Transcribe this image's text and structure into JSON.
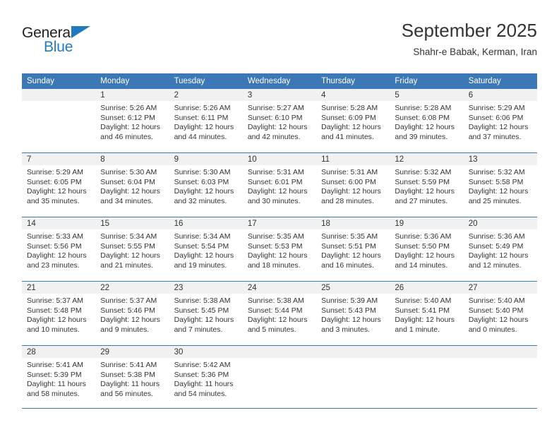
{
  "brand": {
    "name_part1": "General",
    "name_part2": "Blue",
    "accent_color": "#1f7ac0"
  },
  "header": {
    "title": "September 2025",
    "subtitle": "Shahr-e Babak, Kerman, Iran",
    "header_bg_color": "#3b78b5",
    "daynum_band_color": "#f1f1f1"
  },
  "weekdays": [
    "Sunday",
    "Monday",
    "Tuesday",
    "Wednesday",
    "Thursday",
    "Friday",
    "Saturday"
  ],
  "labels": {
    "sunrise_prefix": "Sunrise:",
    "sunset_prefix": "Sunset:",
    "daylight_prefix": "Daylight:"
  },
  "weeks": [
    [
      {
        "day": "",
        "sunrise": "",
        "sunset": "",
        "daylight_line1": "",
        "daylight_line2": "",
        "empty": true
      },
      {
        "day": "1",
        "sunrise": "Sunrise: 5:26 AM",
        "sunset": "Sunset: 6:12 PM",
        "daylight_line1": "Daylight: 12 hours",
        "daylight_line2": "and 46 minutes.",
        "empty": false
      },
      {
        "day": "2",
        "sunrise": "Sunrise: 5:26 AM",
        "sunset": "Sunset: 6:11 PM",
        "daylight_line1": "Daylight: 12 hours",
        "daylight_line2": "and 44 minutes.",
        "empty": false
      },
      {
        "day": "3",
        "sunrise": "Sunrise: 5:27 AM",
        "sunset": "Sunset: 6:10 PM",
        "daylight_line1": "Daylight: 12 hours",
        "daylight_line2": "and 42 minutes.",
        "empty": false
      },
      {
        "day": "4",
        "sunrise": "Sunrise: 5:28 AM",
        "sunset": "Sunset: 6:09 PM",
        "daylight_line1": "Daylight: 12 hours",
        "daylight_line2": "and 41 minutes.",
        "empty": false
      },
      {
        "day": "5",
        "sunrise": "Sunrise: 5:28 AM",
        "sunset": "Sunset: 6:08 PM",
        "daylight_line1": "Daylight: 12 hours",
        "daylight_line2": "and 39 minutes.",
        "empty": false
      },
      {
        "day": "6",
        "sunrise": "Sunrise: 5:29 AM",
        "sunset": "Sunset: 6:06 PM",
        "daylight_line1": "Daylight: 12 hours",
        "daylight_line2": "and 37 minutes.",
        "empty": false
      }
    ],
    [
      {
        "day": "7",
        "sunrise": "Sunrise: 5:29 AM",
        "sunset": "Sunset: 6:05 PM",
        "daylight_line1": "Daylight: 12 hours",
        "daylight_line2": "and 35 minutes.",
        "empty": false
      },
      {
        "day": "8",
        "sunrise": "Sunrise: 5:30 AM",
        "sunset": "Sunset: 6:04 PM",
        "daylight_line1": "Daylight: 12 hours",
        "daylight_line2": "and 34 minutes.",
        "empty": false
      },
      {
        "day": "9",
        "sunrise": "Sunrise: 5:30 AM",
        "sunset": "Sunset: 6:03 PM",
        "daylight_line1": "Daylight: 12 hours",
        "daylight_line2": "and 32 minutes.",
        "empty": false
      },
      {
        "day": "10",
        "sunrise": "Sunrise: 5:31 AM",
        "sunset": "Sunset: 6:01 PM",
        "daylight_line1": "Daylight: 12 hours",
        "daylight_line2": "and 30 minutes.",
        "empty": false
      },
      {
        "day": "11",
        "sunrise": "Sunrise: 5:31 AM",
        "sunset": "Sunset: 6:00 PM",
        "daylight_line1": "Daylight: 12 hours",
        "daylight_line2": "and 28 minutes.",
        "empty": false
      },
      {
        "day": "12",
        "sunrise": "Sunrise: 5:32 AM",
        "sunset": "Sunset: 5:59 PM",
        "daylight_line1": "Daylight: 12 hours",
        "daylight_line2": "and 27 minutes.",
        "empty": false
      },
      {
        "day": "13",
        "sunrise": "Sunrise: 5:32 AM",
        "sunset": "Sunset: 5:58 PM",
        "daylight_line1": "Daylight: 12 hours",
        "daylight_line2": "and 25 minutes.",
        "empty": false
      }
    ],
    [
      {
        "day": "14",
        "sunrise": "Sunrise: 5:33 AM",
        "sunset": "Sunset: 5:56 PM",
        "daylight_line1": "Daylight: 12 hours",
        "daylight_line2": "and 23 minutes.",
        "empty": false
      },
      {
        "day": "15",
        "sunrise": "Sunrise: 5:34 AM",
        "sunset": "Sunset: 5:55 PM",
        "daylight_line1": "Daylight: 12 hours",
        "daylight_line2": "and 21 minutes.",
        "empty": false
      },
      {
        "day": "16",
        "sunrise": "Sunrise: 5:34 AM",
        "sunset": "Sunset: 5:54 PM",
        "daylight_line1": "Daylight: 12 hours",
        "daylight_line2": "and 19 minutes.",
        "empty": false
      },
      {
        "day": "17",
        "sunrise": "Sunrise: 5:35 AM",
        "sunset": "Sunset: 5:53 PM",
        "daylight_line1": "Daylight: 12 hours",
        "daylight_line2": "and 18 minutes.",
        "empty": false
      },
      {
        "day": "18",
        "sunrise": "Sunrise: 5:35 AM",
        "sunset": "Sunset: 5:51 PM",
        "daylight_line1": "Daylight: 12 hours",
        "daylight_line2": "and 16 minutes.",
        "empty": false
      },
      {
        "day": "19",
        "sunrise": "Sunrise: 5:36 AM",
        "sunset": "Sunset: 5:50 PM",
        "daylight_line1": "Daylight: 12 hours",
        "daylight_line2": "and 14 minutes.",
        "empty": false
      },
      {
        "day": "20",
        "sunrise": "Sunrise: 5:36 AM",
        "sunset": "Sunset: 5:49 PM",
        "daylight_line1": "Daylight: 12 hours",
        "daylight_line2": "and 12 minutes.",
        "empty": false
      }
    ],
    [
      {
        "day": "21",
        "sunrise": "Sunrise: 5:37 AM",
        "sunset": "Sunset: 5:48 PM",
        "daylight_line1": "Daylight: 12 hours",
        "daylight_line2": "and 10 minutes.",
        "empty": false
      },
      {
        "day": "22",
        "sunrise": "Sunrise: 5:37 AM",
        "sunset": "Sunset: 5:46 PM",
        "daylight_line1": "Daylight: 12 hours",
        "daylight_line2": "and 9 minutes.",
        "empty": false
      },
      {
        "day": "23",
        "sunrise": "Sunrise: 5:38 AM",
        "sunset": "Sunset: 5:45 PM",
        "daylight_line1": "Daylight: 12 hours",
        "daylight_line2": "and 7 minutes.",
        "empty": false
      },
      {
        "day": "24",
        "sunrise": "Sunrise: 5:38 AM",
        "sunset": "Sunset: 5:44 PM",
        "daylight_line1": "Daylight: 12 hours",
        "daylight_line2": "and 5 minutes.",
        "empty": false
      },
      {
        "day": "25",
        "sunrise": "Sunrise: 5:39 AM",
        "sunset": "Sunset: 5:43 PM",
        "daylight_line1": "Daylight: 12 hours",
        "daylight_line2": "and 3 minutes.",
        "empty": false
      },
      {
        "day": "26",
        "sunrise": "Sunrise: 5:40 AM",
        "sunset": "Sunset: 5:41 PM",
        "daylight_line1": "Daylight: 12 hours",
        "daylight_line2": "and 1 minute.",
        "empty": false
      },
      {
        "day": "27",
        "sunrise": "Sunrise: 5:40 AM",
        "sunset": "Sunset: 5:40 PM",
        "daylight_line1": "Daylight: 12 hours",
        "daylight_line2": "and 0 minutes.",
        "empty": false
      }
    ],
    [
      {
        "day": "28",
        "sunrise": "Sunrise: 5:41 AM",
        "sunset": "Sunset: 5:39 PM",
        "daylight_line1": "Daylight: 11 hours",
        "daylight_line2": "and 58 minutes.",
        "empty": false
      },
      {
        "day": "29",
        "sunrise": "Sunrise: 5:41 AM",
        "sunset": "Sunset: 5:38 PM",
        "daylight_line1": "Daylight: 11 hours",
        "daylight_line2": "and 56 minutes.",
        "empty": false
      },
      {
        "day": "30",
        "sunrise": "Sunrise: 5:42 AM",
        "sunset": "Sunset: 5:36 PM",
        "daylight_line1": "Daylight: 11 hours",
        "daylight_line2": "and 54 minutes.",
        "empty": false
      },
      {
        "day": "",
        "sunrise": "",
        "sunset": "",
        "daylight_line1": "",
        "daylight_line2": "",
        "empty": true
      },
      {
        "day": "",
        "sunrise": "",
        "sunset": "",
        "daylight_line1": "",
        "daylight_line2": "",
        "empty": true
      },
      {
        "day": "",
        "sunrise": "",
        "sunset": "",
        "daylight_line1": "",
        "daylight_line2": "",
        "empty": true
      },
      {
        "day": "",
        "sunrise": "",
        "sunset": "",
        "daylight_line1": "",
        "daylight_line2": "",
        "empty": true
      }
    ]
  ]
}
